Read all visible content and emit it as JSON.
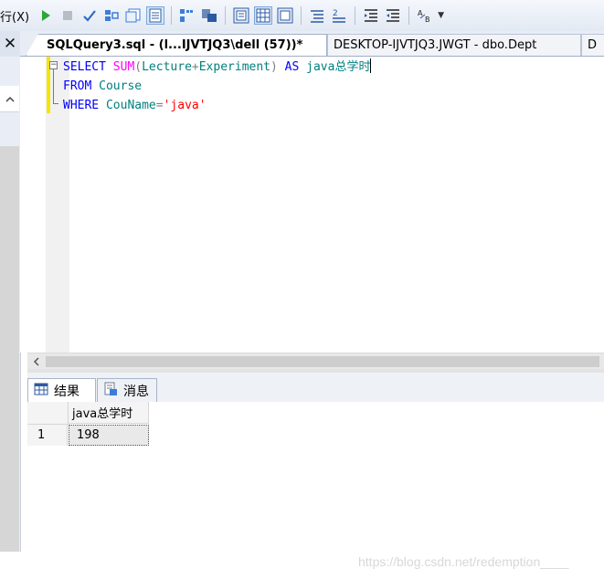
{
  "toolbar": {
    "menu_label": "行(X)",
    "buttons": [
      {
        "icon": "execute-icon"
      },
      {
        "icon": "stop-icon"
      },
      {
        "icon": "parse-checkmark-icon"
      },
      {
        "icon": "debug-icon"
      },
      {
        "icon": "results-to-text-icon"
      },
      {
        "icon": "results-to-grid-icon",
        "active": true
      },
      {
        "icon": "query-options-icon"
      },
      {
        "icon": "include-plan-icon"
      },
      {
        "icon": "client-statistics-icon"
      },
      {
        "icon": "results-to-file-icon"
      },
      {
        "icon": "comment-icon"
      },
      {
        "icon": "uncomment-icon"
      },
      {
        "icon": "decrease-indent-icon"
      },
      {
        "icon": "increase-indent-icon"
      },
      {
        "icon": "specify-values-icon"
      }
    ]
  },
  "tabs": [
    {
      "label": "SQLQuery3.sql - (l...IJVTJQ3\\dell (57))*",
      "active": true
    },
    {
      "label": "DESKTOP-IJVTJQ3.JWGT - dbo.Dept",
      "active": false
    },
    {
      "label": "D",
      "active": false
    }
  ],
  "editor": {
    "line1": {
      "kw1": "SELECT",
      "fn": "SUM",
      "p1": "(",
      "col1": "Lecture",
      "op": "+",
      "col2": "Experiment",
      "p2": ")",
      "kw2": "AS",
      "alias": "java总学时"
    },
    "line2": {
      "kw": "FROM",
      "table": "Course"
    },
    "line3": {
      "kw": "WHERE",
      "col": "CouName",
      "op": "=",
      "value": "'java'"
    }
  },
  "results": {
    "tabs": [
      {
        "label": "结果",
        "icon": "grid-results-icon",
        "active": true
      },
      {
        "label": "消息",
        "icon": "messages-icon",
        "active": false
      }
    ],
    "columns": [
      "java总学时"
    ],
    "rows": [
      {
        "row_number": "1",
        "values": [
          "198"
        ]
      }
    ]
  },
  "watermark": "https://blog.csdn.net/redemption____",
  "colors": {
    "keyword": "#0000ff",
    "function": "#ff00ff",
    "identifier": "#008080",
    "string": "#ff0000",
    "punctuation": "#808080",
    "change_marker": "#f3e600"
  }
}
